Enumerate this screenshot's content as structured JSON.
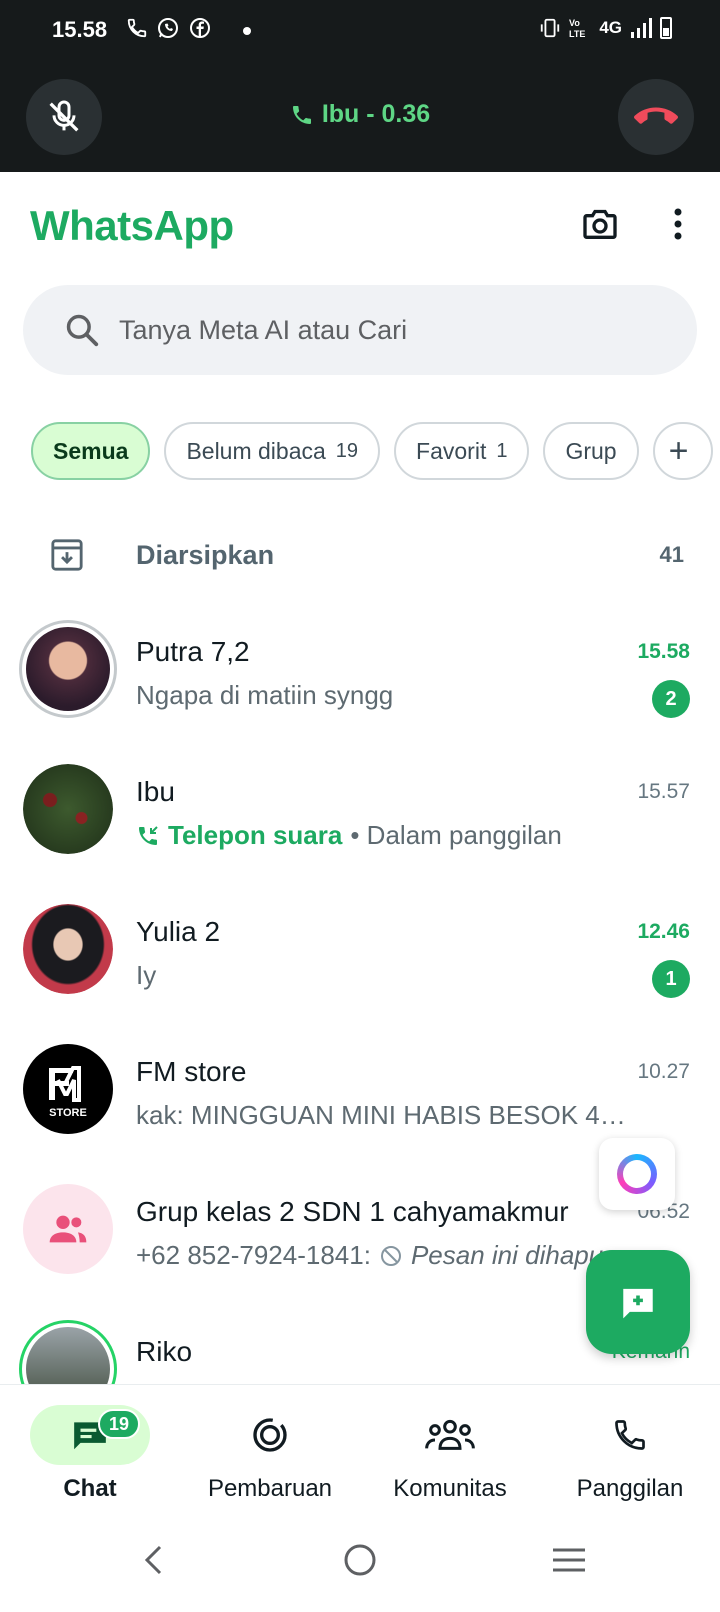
{
  "status_bar": {
    "time": "15.58",
    "network": "4G",
    "icons": [
      "phone-icon",
      "whatsapp-icon",
      "facebook-icon",
      "vibrate-icon",
      "volte-icon",
      "signal-icon",
      "battery-icon"
    ]
  },
  "ongoing_call": {
    "label": "Ibu - 0.36",
    "color": "#5ed685"
  },
  "header": {
    "title": "WhatsApp",
    "brand_color": "#1daa61"
  },
  "search": {
    "placeholder": "Tanya Meta AI atau Cari"
  },
  "filters": [
    {
      "label": "Semua",
      "count": "",
      "active": true
    },
    {
      "label": "Belum dibaca",
      "count": "19",
      "active": false
    },
    {
      "label": "Favorit",
      "count": "1",
      "active": false
    },
    {
      "label": "Grup",
      "count": "",
      "active": false
    },
    {
      "label": "+",
      "count": "",
      "active": false
    }
  ],
  "archived": {
    "label": "Diarsipkan",
    "count": "41"
  },
  "chats": [
    {
      "name": "Putra 7,2",
      "time": "15.58",
      "preview": "Ngapa di matiin syngg",
      "unread": "2"
    },
    {
      "name": "Ibu",
      "time": "15.57",
      "preview_highlight": "Telepon suara",
      "preview": "• Dalam panggilan",
      "unread": ""
    },
    {
      "name": "Yulia 2",
      "time": "12.46",
      "preview": "Iy",
      "unread": "1"
    },
    {
      "name": "FM store",
      "time": "10.27",
      "preview": "kak: MINGGUAN  MINI HABIS BESOK 4K...",
      "unread": "",
      "avatar_text": "STORE"
    },
    {
      "name": "Grup kelas 2 SDN 1 cahyamakmur",
      "time": "06.52",
      "preview_sender": "+62 852-7924-1841:",
      "preview": "Pesan ini dihapus",
      "unread": ""
    },
    {
      "name": "Riko",
      "time": "Kemarin",
      "preview": "",
      "unread": ""
    }
  ],
  "bottom_nav": [
    {
      "label": "Chat",
      "badge": "19",
      "active": true
    },
    {
      "label": "Pembaruan",
      "badge": "",
      "active": false
    },
    {
      "label": "Komunitas",
      "badge": "",
      "active": false
    },
    {
      "label": "Panggilan",
      "badge": "",
      "active": false
    }
  ]
}
